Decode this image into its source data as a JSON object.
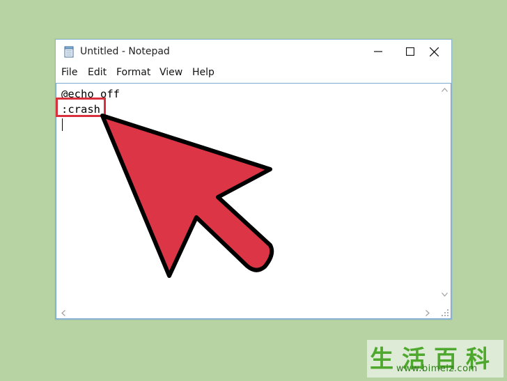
{
  "window": {
    "title": "Untitled - Notepad",
    "icon": "notepad-icon"
  },
  "window_controls": {
    "minimize": "minimize-icon",
    "maximize": "maximize-icon",
    "close": "close-icon"
  },
  "menu": {
    "items": [
      "File",
      "Edit",
      "Format",
      "View",
      "Help"
    ]
  },
  "editor": {
    "lines": [
      "@echo off",
      ":crash",
      ""
    ]
  },
  "annotation": {
    "arrow_color": "#dc3545",
    "box_color": "#d9303e"
  },
  "watermark": {
    "chars": "生活百科",
    "url": "www.bimeiz.com"
  }
}
